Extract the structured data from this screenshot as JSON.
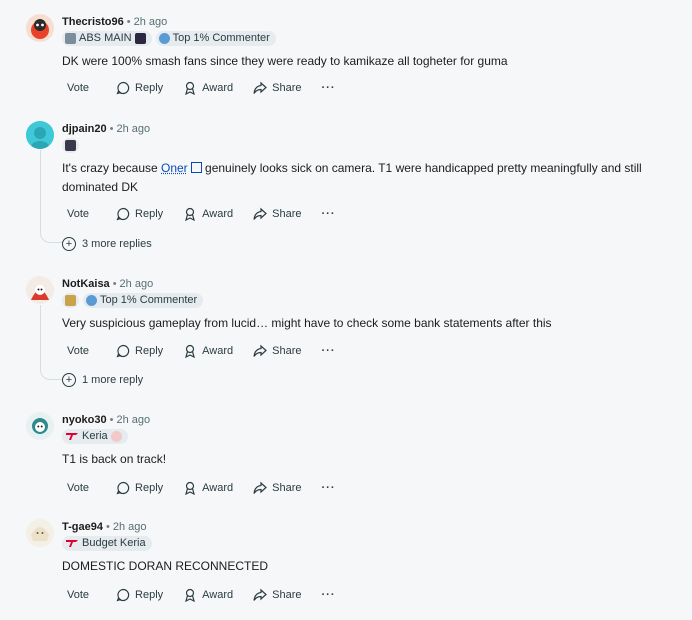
{
  "actions": {
    "vote": "Vote",
    "reply": "Reply",
    "award": "Award",
    "share": "Share",
    "more": "···"
  },
  "colors": {
    "link": "#0a49b8",
    "flair_bg": "#e5ebee",
    "t1_red": "#e2012d",
    "background": "#f6f7f8"
  },
  "comments": [
    {
      "author": "Thecristo96",
      "time": "2h ago",
      "flairs": [
        {
          "label": "ABS MAIN",
          "icon": "abs-emote-icon"
        },
        {
          "label": "Top 1% Commenter",
          "icon": "top-commenter-icon"
        }
      ],
      "text": "DK were 100% smash fans since they were ready to kamikaze all togheter for guma"
    },
    {
      "author": "djpain20",
      "time": "2h ago",
      "flairs": [
        {
          "label": "",
          "icon": "player-emote-icon"
        }
      ],
      "text_before": "It's crazy because ",
      "link": "Oner",
      "text_after": " genuinely looks sick on camera. T1 were handicapped pretty meaningfully and still dominated DK",
      "more_replies": "3 more replies"
    },
    {
      "author": "NotKaisa",
      "time": "2h ago",
      "flairs": [
        {
          "label": "",
          "icon": "team-logo-icon"
        },
        {
          "label": "Top 1% Commenter",
          "icon": "top-commenter-icon"
        }
      ],
      "text": "Very suspicious gameplay from lucid… might have to check some bank statements after this",
      "more_replies": "1 more reply"
    },
    {
      "author": "nyoko30",
      "time": "2h ago",
      "flairs": [
        {
          "label": "Keria",
          "icon": "t1-logo-icon"
        }
      ],
      "text": "T1 is back on track!"
    },
    {
      "author": "T-gae94",
      "time": "2h ago",
      "flairs": [
        {
          "label": "Budget Keria",
          "icon": "t1-logo-icon"
        }
      ],
      "text": "DOMESTIC DORAN RECONNECTED"
    }
  ]
}
